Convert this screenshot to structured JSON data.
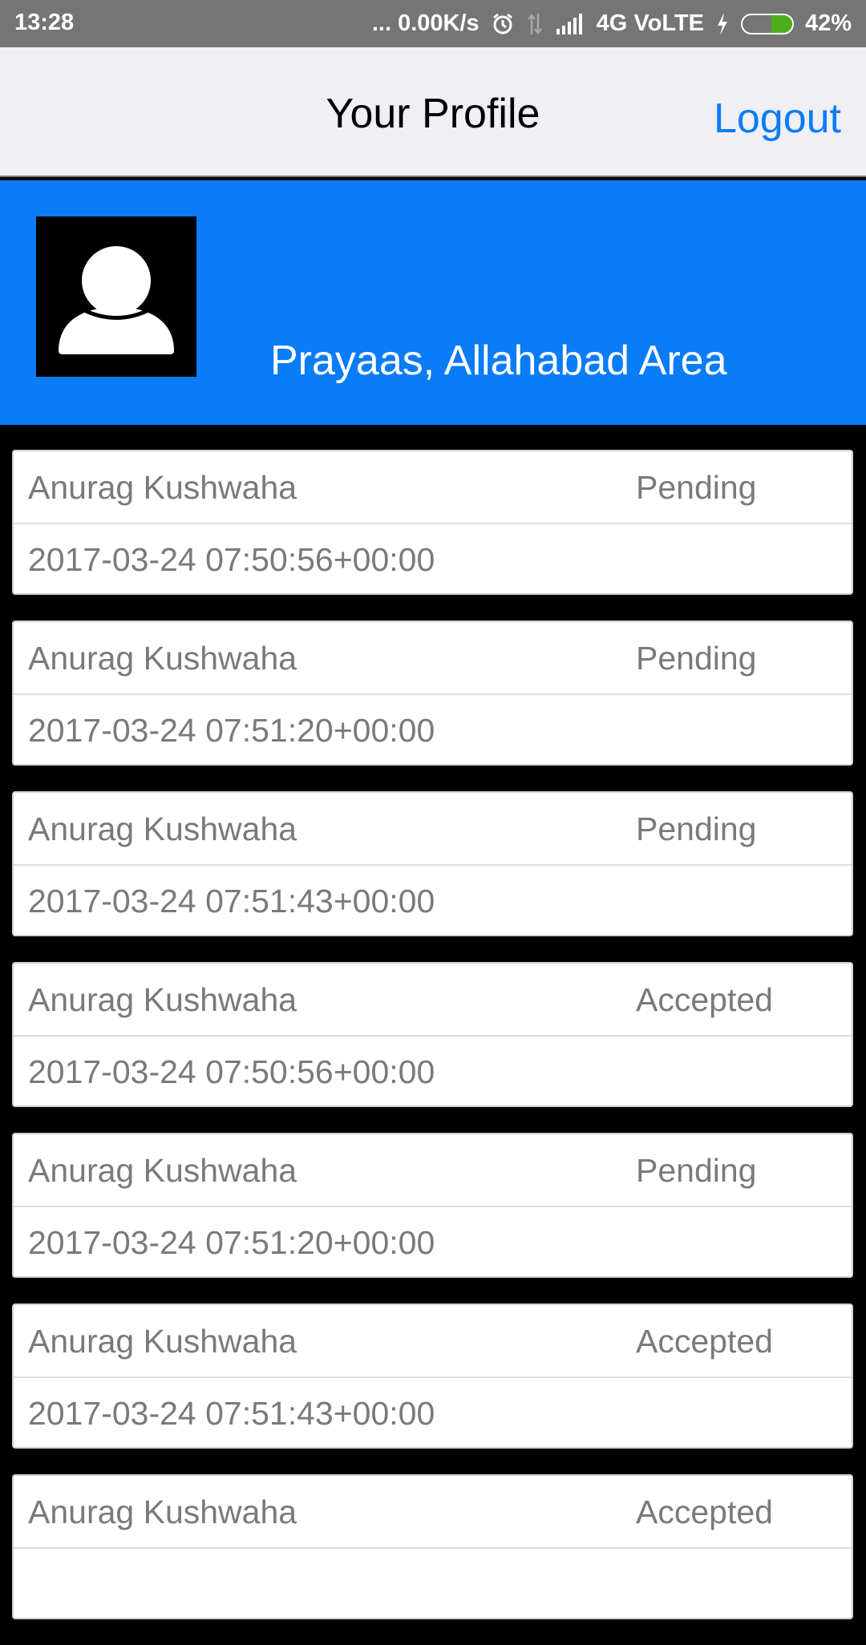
{
  "status_bar": {
    "time": "13:28",
    "network_speed": "... 0.00K/s",
    "network_type": "4G VoLTE",
    "battery_percent": "42%",
    "battery_level": 0.42,
    "icons": [
      "alarm-icon",
      "data-arrows-icon",
      "signal-icon",
      "charging-icon",
      "battery-icon"
    ]
  },
  "nav": {
    "title": "Your Profile",
    "logout_label": "Logout"
  },
  "profile": {
    "name": "Prayaas, Allahabad Area",
    "avatar_icon": "user-avatar-icon"
  },
  "colors": {
    "accent": "#0a7cf6",
    "status_bar": "#757575",
    "nav_bg": "#efeff4",
    "card_text": "#7a7a7a",
    "battery_fill": "#4caf1a"
  },
  "requests": [
    {
      "name": "Anurag Kushwaha",
      "status": "Pending",
      "timestamp": "2017-03-24 07:50:56+00:00"
    },
    {
      "name": "Anurag Kushwaha",
      "status": "Pending",
      "timestamp": "2017-03-24 07:51:20+00:00"
    },
    {
      "name": "Anurag Kushwaha",
      "status": "Pending",
      "timestamp": "2017-03-24 07:51:43+00:00"
    },
    {
      "name": "Anurag Kushwaha",
      "status": "Accepted",
      "timestamp": "2017-03-24 07:50:56+00:00"
    },
    {
      "name": "Anurag Kushwaha",
      "status": "Pending",
      "timestamp": "2017-03-24 07:51:20+00:00"
    },
    {
      "name": "Anurag Kushwaha",
      "status": "Accepted",
      "timestamp": "2017-03-24 07:51:43+00:00"
    },
    {
      "name": "Anurag Kushwaha",
      "status": "Accepted",
      "timestamp": ""
    }
  ]
}
